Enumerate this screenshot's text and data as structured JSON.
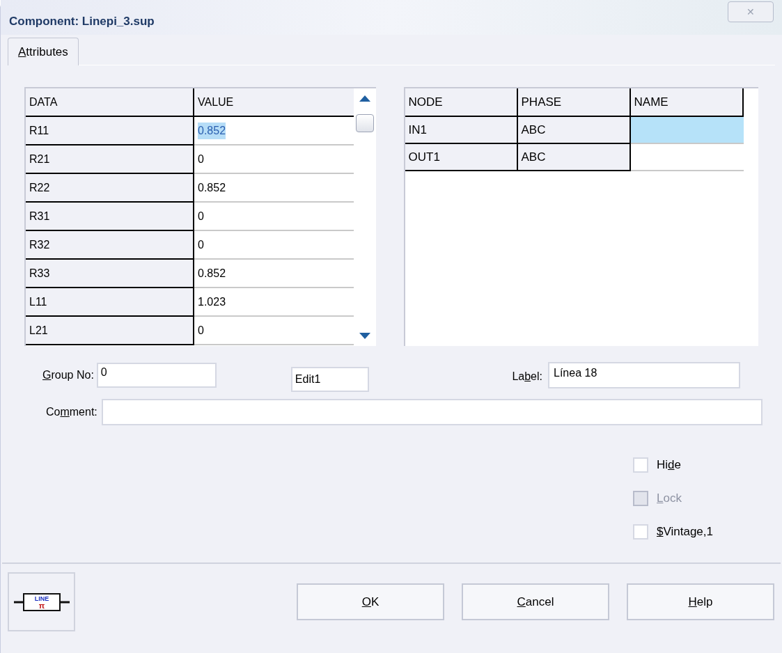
{
  "window": {
    "title": "Component: Linepi_3.sup",
    "close": "✕"
  },
  "tabs": [
    {
      "key": "A",
      "after": "ttributes",
      "selected": true
    }
  ],
  "data_table": {
    "columns": [
      "DATA",
      "VALUE"
    ],
    "rows": [
      {
        "data": "R11",
        "value": "0.852",
        "selected": true
      },
      {
        "data": "R21",
        "value": "0",
        "selected": false
      },
      {
        "data": "R22",
        "value": "0.852",
        "selected": false
      },
      {
        "data": "R31",
        "value": "0",
        "selected": false
      },
      {
        "data": "R32",
        "value": "0",
        "selected": false
      },
      {
        "data": "R33",
        "value": "0.852",
        "selected": false
      },
      {
        "data": "L11",
        "value": "1.023",
        "selected": false
      },
      {
        "data": "L21",
        "value": "0",
        "selected": false
      }
    ]
  },
  "node_table": {
    "columns": [
      "NODE",
      "PHASE",
      "NAME"
    ],
    "rows": [
      {
        "node": "IN1",
        "phase": "ABC",
        "selected": true
      },
      {
        "node": "OUT1",
        "phase": "ABC",
        "selected": false
      }
    ]
  },
  "group_no": {
    "key": "G",
    "after": "roup No:",
    "value": "0"
  },
  "edit1": {
    "value": "Edit1"
  },
  "label": {
    "before": "La",
    "key": "b",
    "after": "el:",
    "value": "Línea 18"
  },
  "comment": {
    "before": "Co",
    "key": "m",
    "after": "ment:"
  },
  "checkboxes": [
    {
      "before": "Hi",
      "key": "d",
      "after": "e",
      "checked": false,
      "disabled": false
    },
    {
      "key": "L",
      "after": "ock",
      "checked": false,
      "disabled": true
    },
    {
      "key": "$",
      "after": "Vintage,1",
      "checked": false,
      "disabled": false
    }
  ],
  "component_icon": {
    "top": "LINE",
    "bottom": "π"
  },
  "buttons": [
    {
      "key": "O",
      "after": "K"
    },
    {
      "key": "C",
      "after": "ancel"
    },
    {
      "key": "H",
      "after": "elp"
    }
  ]
}
